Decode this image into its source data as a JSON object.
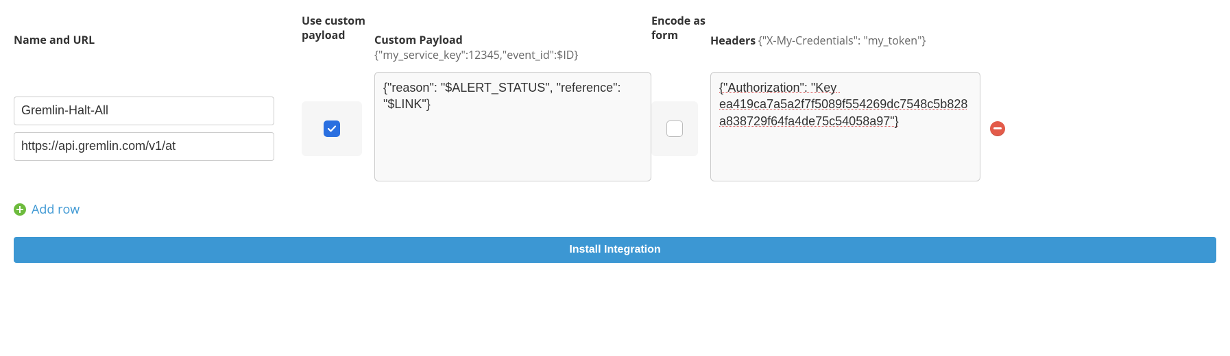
{
  "columns": {
    "name_url": "Name and URL",
    "use_custom": "Use custom payload",
    "custom_payload": {
      "label": "Custom Payload",
      "placeholder": "{\"my_service_key\":12345,\"event_id\":$ID}"
    },
    "encode_form": "Encode as form",
    "headers": {
      "label": "Headers",
      "placeholder": "{\"X-My-Credentials\": \"my_token\"}"
    }
  },
  "row": {
    "name": "Gremlin-Halt-All",
    "url": "https://api.gremlin.com/v1/at",
    "use_custom_payload": true,
    "custom_payload_value": "{\"reason\": \"$ALERT_STATUS\", \"reference\": \"$LINK\"}",
    "encode_as_form": false,
    "headers_value": "{\"Authorization\": \"Key ea419ca7a5a2f7f5089f554269dc7548c5b828a838729f64fa4de75c54058a97\"}"
  },
  "actions": {
    "add_row": "Add row",
    "install": "Install Integration"
  }
}
